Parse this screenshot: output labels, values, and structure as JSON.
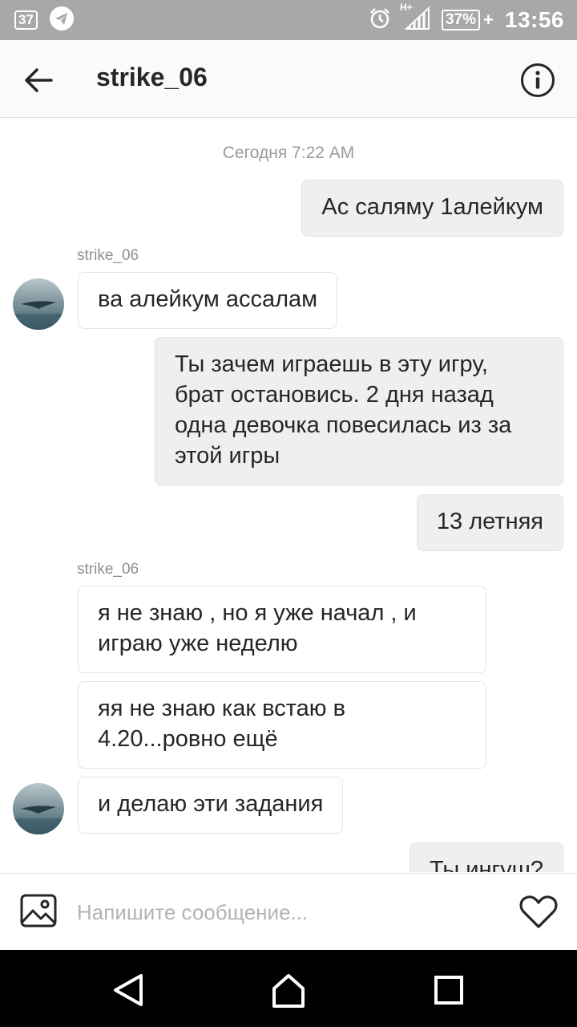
{
  "status_bar": {
    "notification_badge": "37",
    "network": "H+",
    "battery": "37%",
    "time": "13:56"
  },
  "header": {
    "title": "strike_06"
  },
  "conversation": {
    "date_separator": "Сегодня 7:22 AM",
    "messages": [
      {
        "direction": "out",
        "text": "Ас саляму 1алейкум"
      },
      {
        "direction": "in",
        "sender": "strike_06",
        "text": "ва алейкум ассалам"
      },
      {
        "direction": "out",
        "text": "Ты зачем играешь в эту игру, брат остановись. 2 дня назад одна девочка повесилась из за этой игры"
      },
      {
        "direction": "out",
        "text": "13 летняя"
      },
      {
        "direction": "in",
        "sender": "strike_06",
        "text": "я не знаю , но я уже начал , и играю уже  неделю"
      },
      {
        "direction": "in",
        "text": "яя не знаю как встаю в 4.20...ровно ещё"
      },
      {
        "direction": "in",
        "text": "и делаю эти задания"
      },
      {
        "direction": "out",
        "text": "Ты ингуш?"
      }
    ]
  },
  "composer": {
    "placeholder": "Напишите сообщение...",
    "value": ""
  },
  "icons": {
    "back": "arrow-left-icon",
    "info": "info-icon",
    "gallery": "image-icon",
    "like": "heart-icon"
  },
  "colors": {
    "outgoing_bubble": "#efefef",
    "incoming_bubble": "#ffffff",
    "status_bar": "#a8a8a8",
    "text": "#262626"
  }
}
